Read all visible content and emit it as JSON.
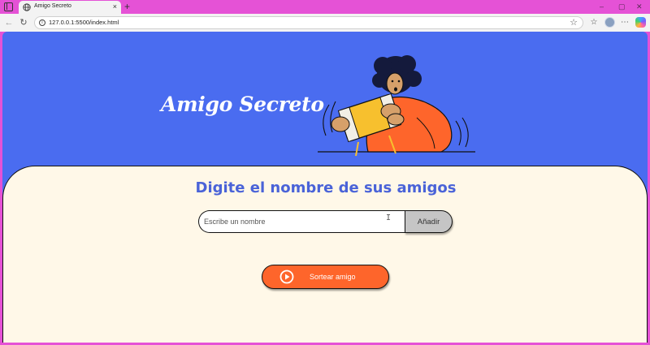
{
  "browser": {
    "tab_title": "Amigo Secreto",
    "tab_close": "×",
    "new_tab": "+",
    "url": "127.0.0.1:5500/index.html",
    "window_controls": {
      "minimize": "–",
      "maximize": "▢",
      "close": "✕"
    },
    "icons": [
      "tab-actions-icon",
      "globe-icon",
      "back-icon",
      "refresh-icon",
      "info-icon",
      "star-icon",
      "favorites-icon",
      "profile-avatar",
      "more-icon",
      "copilot-icon"
    ]
  },
  "page": {
    "title": "Amigo Secreto",
    "subtitle": "Digite el nombre de sus amigos",
    "input": {
      "placeholder": "Escribe un nombre",
      "value": ""
    },
    "add_button": "Añadir",
    "draw_button": "Sortear amigo",
    "colors": {
      "primary": "#4a6cf0",
      "card_bg": "#fff8e8",
      "heading": "#4a63d8",
      "accent": "#fe652b",
      "add_button": "#c5c5c5"
    }
  }
}
